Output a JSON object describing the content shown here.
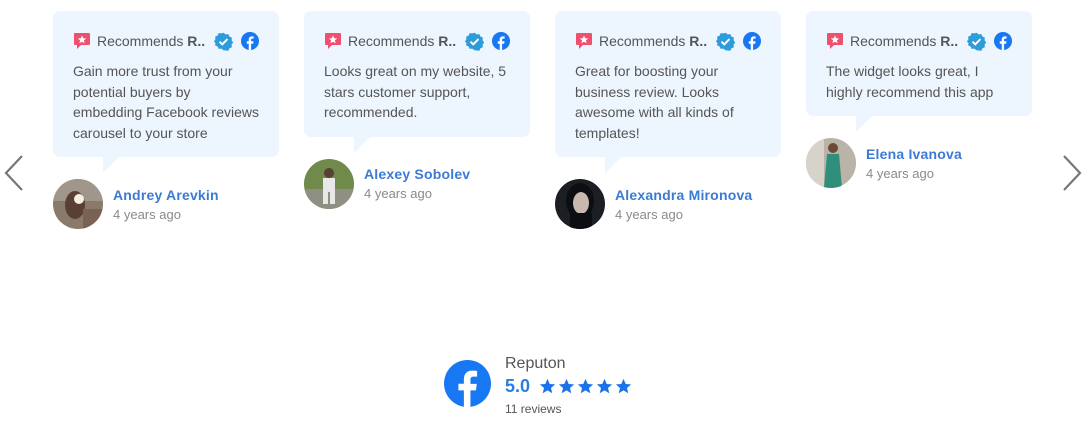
{
  "carousel": {
    "recommends_label": "Recommends",
    "recommends_suffix": "R..",
    "reviews": [
      {
        "text": "Gain more trust from your potential buyers by embedding Facebook reviews carousel to your store",
        "author": "Andrey Arevkin",
        "time": "4 years ago"
      },
      {
        "text": "Looks great on my website, 5 stars customer support, recommended.",
        "author": "Alexey Sobolev",
        "time": "4 years ago"
      },
      {
        "text": "Great for boosting your business review. Looks awesome with all kinds of templates!",
        "author": "Alexandra Mironova",
        "time": "4 years ago"
      },
      {
        "text": "The widget looks great, I highly recommend this app",
        "author": "Elena Ivanova",
        "time": "4 years ago"
      }
    ]
  },
  "summary": {
    "business_name": "Reputon",
    "rating": "5.0",
    "stars": 5,
    "reviews_count": "11 reviews"
  },
  "colors": {
    "bubble_bg": "#edf5ff",
    "author_link": "#3b7bd4",
    "facebook_blue": "#1877f2",
    "recommend_red": "#f0506e",
    "verified_blue": "#2d9cdb",
    "star_blue": "#1a73e8"
  },
  "icons": [
    "chevron-left-icon",
    "chevron-right-icon",
    "recommend-icon",
    "verified-badge-icon",
    "facebook-icon",
    "star-icon"
  ]
}
